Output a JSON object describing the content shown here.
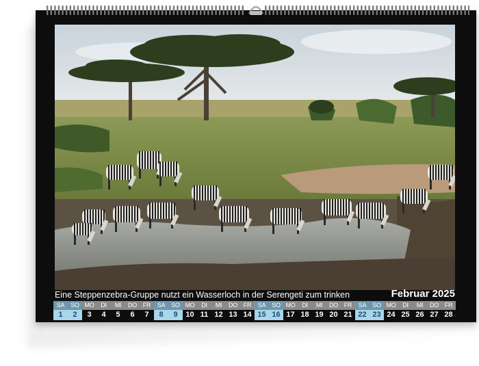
{
  "calendar": {
    "caption": "Eine Steppenzebra-Gruppe nutzt ein Wasserloch in der Serengeti zum trinken",
    "month": "Februar 2025",
    "days": [
      {
        "name": "SA",
        "num": "1",
        "weekend": true
      },
      {
        "name": "SO",
        "num": "2",
        "weekend": true
      },
      {
        "name": "MO",
        "num": "3",
        "weekend": false
      },
      {
        "name": "DI",
        "num": "4",
        "weekend": false
      },
      {
        "name": "MI",
        "num": "5",
        "weekend": false
      },
      {
        "name": "DO",
        "num": "6",
        "weekend": false
      },
      {
        "name": "FR",
        "num": "7",
        "weekend": false
      },
      {
        "name": "SA",
        "num": "8",
        "weekend": true
      },
      {
        "name": "SO",
        "num": "9",
        "weekend": true
      },
      {
        "name": "MO",
        "num": "10",
        "weekend": false
      },
      {
        "name": "DI",
        "num": "11",
        "weekend": false
      },
      {
        "name": "MI",
        "num": "12",
        "weekend": false
      },
      {
        "name": "DO",
        "num": "13",
        "weekend": false
      },
      {
        "name": "FR",
        "num": "14",
        "weekend": false
      },
      {
        "name": "SA",
        "num": "15",
        "weekend": true
      },
      {
        "name": "SO",
        "num": "16",
        "weekend": true
      },
      {
        "name": "MO",
        "num": "17",
        "weekend": false
      },
      {
        "name": "DI",
        "num": "18",
        "weekend": false
      },
      {
        "name": "MI",
        "num": "19",
        "weekend": false
      },
      {
        "name": "DO",
        "num": "20",
        "weekend": false
      },
      {
        "name": "FR",
        "num": "21",
        "weekend": false
      },
      {
        "name": "SA",
        "num": "22",
        "weekend": true
      },
      {
        "name": "SO",
        "num": "23",
        "weekend": true
      },
      {
        "name": "MO",
        "num": "24",
        "weekend": false
      },
      {
        "name": "DI",
        "num": "25",
        "weekend": false
      },
      {
        "name": "MI",
        "num": "26",
        "weekend": false
      },
      {
        "name": "DO",
        "num": "27",
        "weekend": false
      },
      {
        "name": "FR",
        "num": "28",
        "weekend": false
      }
    ]
  },
  "colors": {
    "frame": "#0d0d0d",
    "weekday_header": "#8a8a8a",
    "weekend_header": "#6f97ad",
    "weekend_cell": "#a9d6ea",
    "weekend_text": "#1a4d78"
  }
}
